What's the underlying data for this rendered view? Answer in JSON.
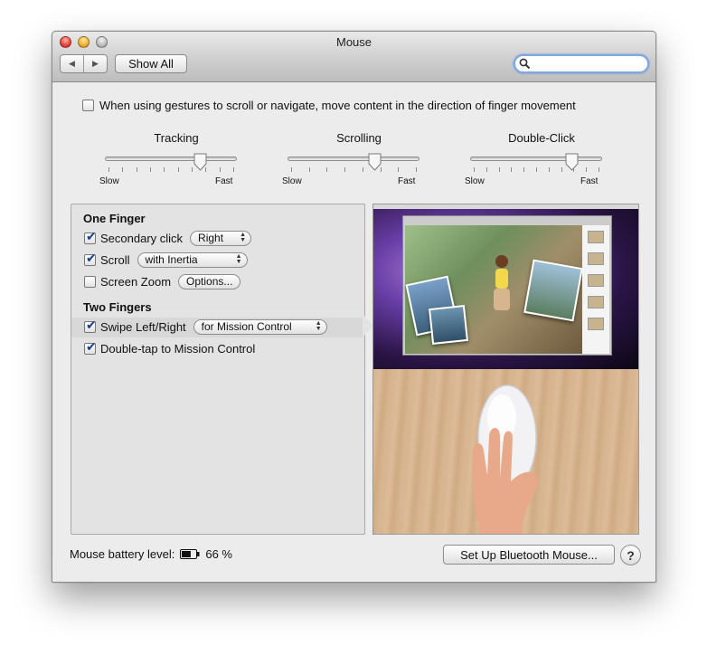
{
  "window": {
    "title": "Mouse",
    "show_all_label": "Show All",
    "nav_back_icon": "◀",
    "nav_forward_icon": "▶",
    "search_value": ""
  },
  "natural_scroll": {
    "label": "When using gestures to scroll or navigate, move content in the direction of finger movement",
    "checked": false
  },
  "sliders": [
    {
      "title": "Tracking",
      "slow": "Slow",
      "fast": "Fast",
      "value": 0.75,
      "ticks": 10
    },
    {
      "title": "Scrolling",
      "slow": "Slow",
      "fast": "Fast",
      "value": 0.68,
      "ticks": 8
    },
    {
      "title": "Double-Click",
      "slow": "Slow",
      "fast": "Fast",
      "value": 0.8,
      "ticks": 11
    }
  ],
  "one_finger": {
    "heading": "One Finger",
    "secondary_click": {
      "label": "Secondary click",
      "checked": true,
      "option": "Right"
    },
    "scroll": {
      "label": "Scroll",
      "checked": true,
      "option": "with Inertia"
    },
    "screen_zoom": {
      "label": "Screen Zoom",
      "checked": false,
      "button": "Options..."
    }
  },
  "two_fingers": {
    "heading": "Two Fingers",
    "swipe": {
      "label": "Swipe Left/Right",
      "checked": true,
      "option": "for Mission Control"
    },
    "double_tap": {
      "label": "Double-tap to Mission Control",
      "checked": true
    }
  },
  "footer": {
    "battery_label": "Mouse battery level:",
    "battery_value": "66 %",
    "battery_level": 0.66,
    "bluetooth_button": "Set Up Bluetooth Mouse...",
    "help_label": "?"
  },
  "colors": {
    "focus_ring": "#7fa8e0",
    "check_mark": "#1a3e8c",
    "window_bg": "#ececec"
  }
}
